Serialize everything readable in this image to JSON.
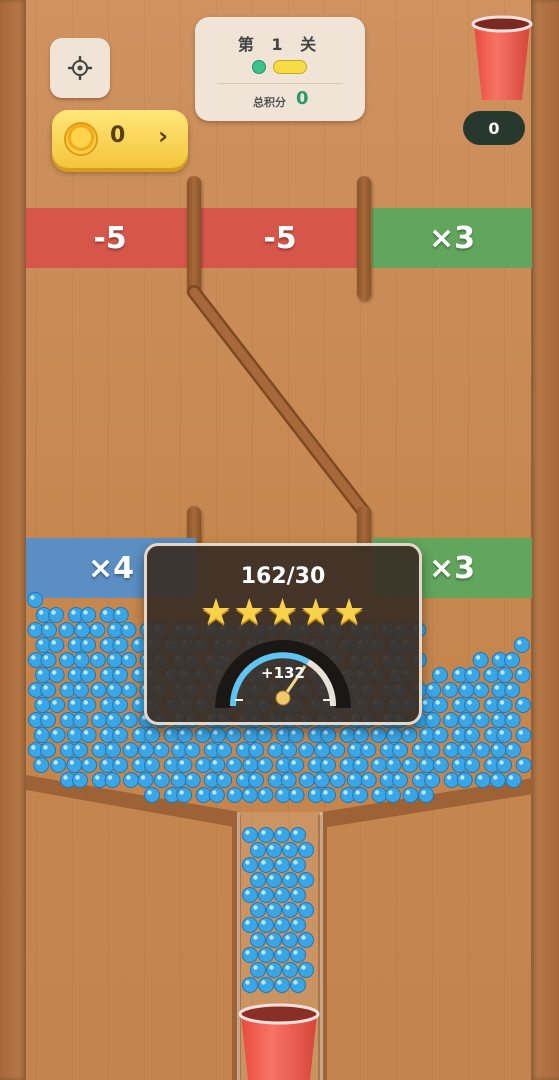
{
  "header": {
    "settings_icon": "gear-icon",
    "coins": {
      "icon": "coin-icon",
      "value": "0",
      "arrow": "›"
    },
    "level": {
      "title": "第 1 关",
      "score_label": "总积分",
      "score": "0",
      "progress_icons": [
        "green-dot",
        "yellow-bar"
      ]
    },
    "cup_counter": {
      "icon": "red-cup-icon",
      "value": "0"
    }
  },
  "zones_top": [
    {
      "label": "-5",
      "color": "#d6564a"
    },
    {
      "label": "-5",
      "color": "#d6564a"
    },
    {
      "label": "×3",
      "color": "#62a65e"
    }
  ],
  "zones_mid": [
    {
      "label": "×4",
      "color": "#5b8ec2"
    },
    {
      "label": "×3",
      "color": "#62a65e"
    }
  ],
  "popup": {
    "score": "162/30",
    "stars": 5,
    "stars_text": "★★★★★",
    "gauge_value": "+132"
  },
  "colors": {
    "ball": "#3aa6e6",
    "cup": "#ef5a4a",
    "wood": "#c98a55"
  }
}
